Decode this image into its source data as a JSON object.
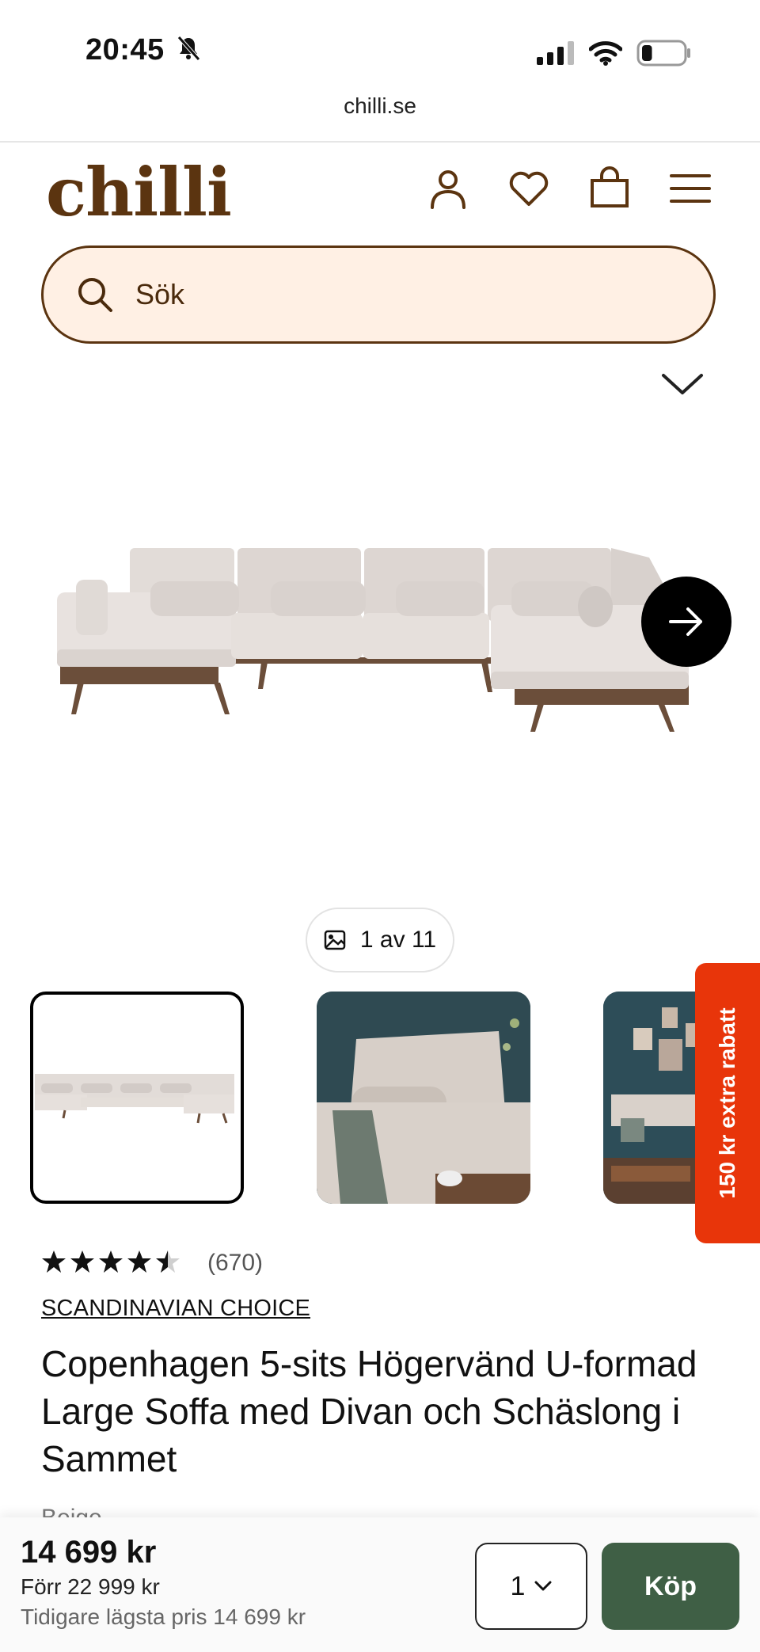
{
  "status_bar": {
    "time": "20:45",
    "battery_level": 0.25
  },
  "browser": {
    "url": "chilli.se"
  },
  "header": {
    "logo": "chilli",
    "icons": [
      "user-icon",
      "heart-icon",
      "shopping-bag-icon",
      "menu-icon"
    ]
  },
  "search": {
    "placeholder": "Sök"
  },
  "gallery": {
    "counter": "1 av 11",
    "thumbnails": [
      "thumbnail-1",
      "thumbnail-2",
      "thumbnail-3"
    ],
    "selected_index": 0
  },
  "promo_tab": {
    "label": "150 kr extra rabatt",
    "color": "#e8350a"
  },
  "product": {
    "rating": 4.5,
    "review_count": "(670)",
    "brand": "SCANDINAVIAN CHOICE",
    "title": "Copenhagen 5-sits Högervänd U-formad Large Soffa med Divan och Schäslong i Sammet",
    "color_label": "Beige"
  },
  "purchase_bar": {
    "price": "14 699 kr",
    "previous_price": "Förr 22 999 kr",
    "lowest_price": "Tidigare lägsta pris 14 699 kr",
    "quantity": "1",
    "buy_label": "Köp",
    "buy_color": "#3f5f45"
  },
  "brand_color": "#5b3410"
}
